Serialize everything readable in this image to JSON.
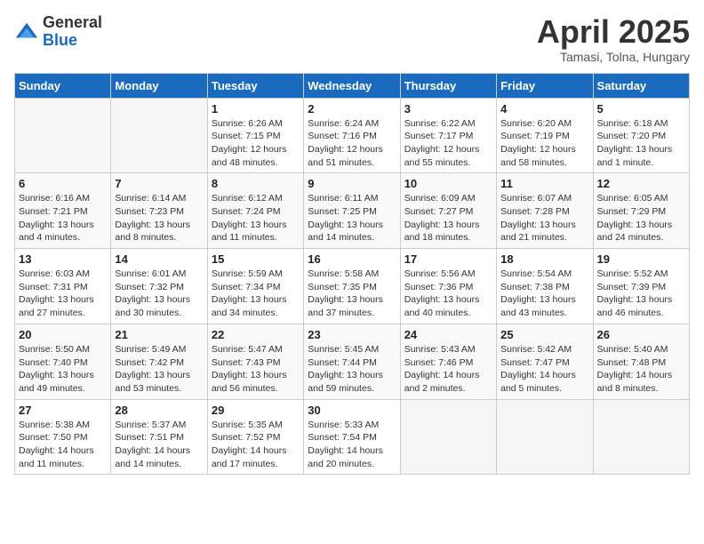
{
  "header": {
    "logo_general": "General",
    "logo_blue": "Blue",
    "month_title": "April 2025",
    "subtitle": "Tamasi, Tolna, Hungary"
  },
  "days_of_week": [
    "Sunday",
    "Monday",
    "Tuesday",
    "Wednesday",
    "Thursday",
    "Friday",
    "Saturday"
  ],
  "weeks": [
    [
      {
        "day": "",
        "sunrise": "",
        "sunset": "",
        "daylight": ""
      },
      {
        "day": "",
        "sunrise": "",
        "sunset": "",
        "daylight": ""
      },
      {
        "day": "1",
        "sunrise": "Sunrise: 6:26 AM",
        "sunset": "Sunset: 7:15 PM",
        "daylight": "Daylight: 12 hours and 48 minutes."
      },
      {
        "day": "2",
        "sunrise": "Sunrise: 6:24 AM",
        "sunset": "Sunset: 7:16 PM",
        "daylight": "Daylight: 12 hours and 51 minutes."
      },
      {
        "day": "3",
        "sunrise": "Sunrise: 6:22 AM",
        "sunset": "Sunset: 7:17 PM",
        "daylight": "Daylight: 12 hours and 55 minutes."
      },
      {
        "day": "4",
        "sunrise": "Sunrise: 6:20 AM",
        "sunset": "Sunset: 7:19 PM",
        "daylight": "Daylight: 12 hours and 58 minutes."
      },
      {
        "day": "5",
        "sunrise": "Sunrise: 6:18 AM",
        "sunset": "Sunset: 7:20 PM",
        "daylight": "Daylight: 13 hours and 1 minute."
      }
    ],
    [
      {
        "day": "6",
        "sunrise": "Sunrise: 6:16 AM",
        "sunset": "Sunset: 7:21 PM",
        "daylight": "Daylight: 13 hours and 4 minutes."
      },
      {
        "day": "7",
        "sunrise": "Sunrise: 6:14 AM",
        "sunset": "Sunset: 7:23 PM",
        "daylight": "Daylight: 13 hours and 8 minutes."
      },
      {
        "day": "8",
        "sunrise": "Sunrise: 6:12 AM",
        "sunset": "Sunset: 7:24 PM",
        "daylight": "Daylight: 13 hours and 11 minutes."
      },
      {
        "day": "9",
        "sunrise": "Sunrise: 6:11 AM",
        "sunset": "Sunset: 7:25 PM",
        "daylight": "Daylight: 13 hours and 14 minutes."
      },
      {
        "day": "10",
        "sunrise": "Sunrise: 6:09 AM",
        "sunset": "Sunset: 7:27 PM",
        "daylight": "Daylight: 13 hours and 18 minutes."
      },
      {
        "day": "11",
        "sunrise": "Sunrise: 6:07 AM",
        "sunset": "Sunset: 7:28 PM",
        "daylight": "Daylight: 13 hours and 21 minutes."
      },
      {
        "day": "12",
        "sunrise": "Sunrise: 6:05 AM",
        "sunset": "Sunset: 7:29 PM",
        "daylight": "Daylight: 13 hours and 24 minutes."
      }
    ],
    [
      {
        "day": "13",
        "sunrise": "Sunrise: 6:03 AM",
        "sunset": "Sunset: 7:31 PM",
        "daylight": "Daylight: 13 hours and 27 minutes."
      },
      {
        "day": "14",
        "sunrise": "Sunrise: 6:01 AM",
        "sunset": "Sunset: 7:32 PM",
        "daylight": "Daylight: 13 hours and 30 minutes."
      },
      {
        "day": "15",
        "sunrise": "Sunrise: 5:59 AM",
        "sunset": "Sunset: 7:34 PM",
        "daylight": "Daylight: 13 hours and 34 minutes."
      },
      {
        "day": "16",
        "sunrise": "Sunrise: 5:58 AM",
        "sunset": "Sunset: 7:35 PM",
        "daylight": "Daylight: 13 hours and 37 minutes."
      },
      {
        "day": "17",
        "sunrise": "Sunrise: 5:56 AM",
        "sunset": "Sunset: 7:36 PM",
        "daylight": "Daylight: 13 hours and 40 minutes."
      },
      {
        "day": "18",
        "sunrise": "Sunrise: 5:54 AM",
        "sunset": "Sunset: 7:38 PM",
        "daylight": "Daylight: 13 hours and 43 minutes."
      },
      {
        "day": "19",
        "sunrise": "Sunrise: 5:52 AM",
        "sunset": "Sunset: 7:39 PM",
        "daylight": "Daylight: 13 hours and 46 minutes."
      }
    ],
    [
      {
        "day": "20",
        "sunrise": "Sunrise: 5:50 AM",
        "sunset": "Sunset: 7:40 PM",
        "daylight": "Daylight: 13 hours and 49 minutes."
      },
      {
        "day": "21",
        "sunrise": "Sunrise: 5:49 AM",
        "sunset": "Sunset: 7:42 PM",
        "daylight": "Daylight: 13 hours and 53 minutes."
      },
      {
        "day": "22",
        "sunrise": "Sunrise: 5:47 AM",
        "sunset": "Sunset: 7:43 PM",
        "daylight": "Daylight: 13 hours and 56 minutes."
      },
      {
        "day": "23",
        "sunrise": "Sunrise: 5:45 AM",
        "sunset": "Sunset: 7:44 PM",
        "daylight": "Daylight: 13 hours and 59 minutes."
      },
      {
        "day": "24",
        "sunrise": "Sunrise: 5:43 AM",
        "sunset": "Sunset: 7:46 PM",
        "daylight": "Daylight: 14 hours and 2 minutes."
      },
      {
        "day": "25",
        "sunrise": "Sunrise: 5:42 AM",
        "sunset": "Sunset: 7:47 PM",
        "daylight": "Daylight: 14 hours and 5 minutes."
      },
      {
        "day": "26",
        "sunrise": "Sunrise: 5:40 AM",
        "sunset": "Sunset: 7:48 PM",
        "daylight": "Daylight: 14 hours and 8 minutes."
      }
    ],
    [
      {
        "day": "27",
        "sunrise": "Sunrise: 5:38 AM",
        "sunset": "Sunset: 7:50 PM",
        "daylight": "Daylight: 14 hours and 11 minutes."
      },
      {
        "day": "28",
        "sunrise": "Sunrise: 5:37 AM",
        "sunset": "Sunset: 7:51 PM",
        "daylight": "Daylight: 14 hours and 14 minutes."
      },
      {
        "day": "29",
        "sunrise": "Sunrise: 5:35 AM",
        "sunset": "Sunset: 7:52 PM",
        "daylight": "Daylight: 14 hours and 17 minutes."
      },
      {
        "day": "30",
        "sunrise": "Sunrise: 5:33 AM",
        "sunset": "Sunset: 7:54 PM",
        "daylight": "Daylight: 14 hours and 20 minutes."
      },
      {
        "day": "",
        "sunrise": "",
        "sunset": "",
        "daylight": ""
      },
      {
        "day": "",
        "sunrise": "",
        "sunset": "",
        "daylight": ""
      },
      {
        "day": "",
        "sunrise": "",
        "sunset": "",
        "daylight": ""
      }
    ]
  ]
}
